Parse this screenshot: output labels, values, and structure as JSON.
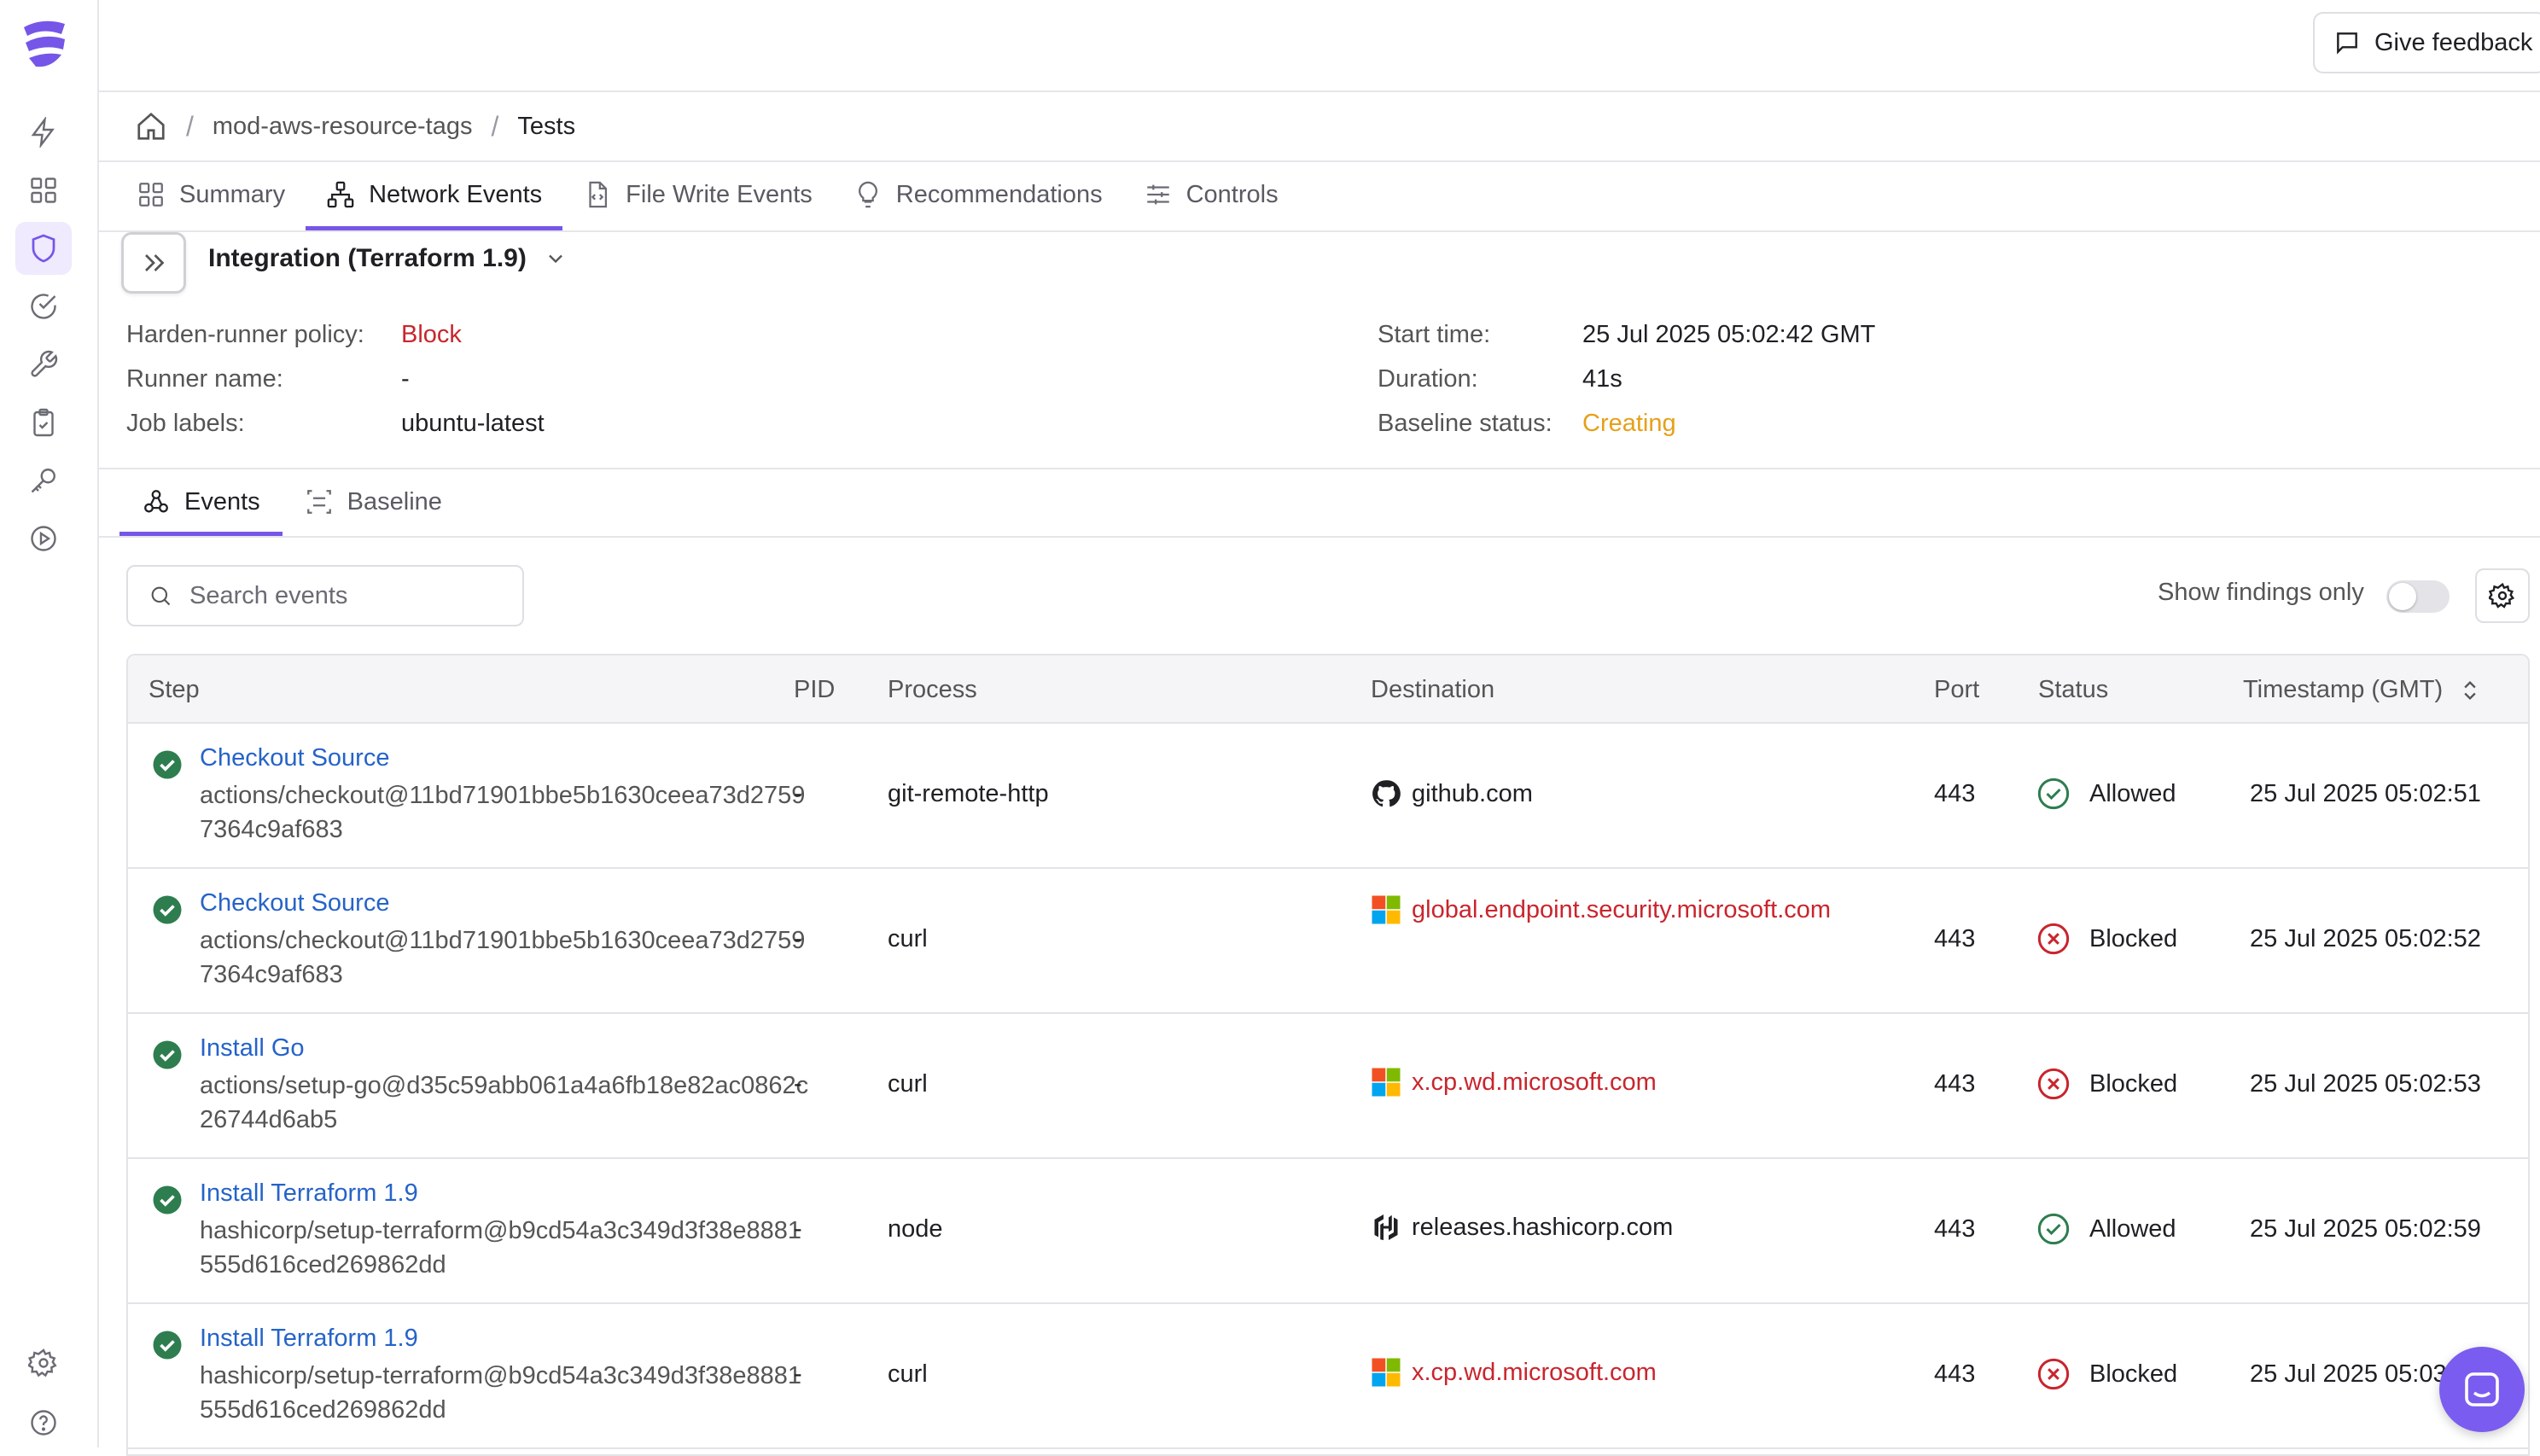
{
  "header": {
    "feedback_label": "Give feedback"
  },
  "breadcrumb": {
    "items": [
      "mod-aws-resource-tags",
      "Tests"
    ]
  },
  "tabs": [
    {
      "label": "Summary",
      "icon": "grid-icon"
    },
    {
      "label": "Network Events",
      "icon": "network-icon",
      "active": true
    },
    {
      "label": "File Write Events",
      "icon": "file-code-icon"
    },
    {
      "label": "Recommendations",
      "icon": "lightbulb-icon"
    },
    {
      "label": "Controls",
      "icon": "sliders-icon"
    }
  ],
  "job": {
    "name": "Integration (Terraform 1.9)",
    "left": [
      {
        "label": "Harden-runner policy:",
        "value": "Block"
      },
      {
        "label": "Runner name:",
        "value": "-"
      },
      {
        "label": "Job labels:",
        "value": "ubuntu-latest"
      }
    ],
    "right": [
      {
        "label": "Start time:",
        "value": "25 Jul 2025 05:02:42 GMT"
      },
      {
        "label": "Duration:",
        "value": "41s"
      },
      {
        "label": "Baseline status:",
        "value": "Creating"
      }
    ]
  },
  "subtabs": [
    {
      "label": "Events",
      "active": true
    },
    {
      "label": "Baseline"
    }
  ],
  "search": {
    "placeholder": "Search events"
  },
  "filters": {
    "findings_label": "Show findings only",
    "findings_enabled": false
  },
  "table": {
    "columns": [
      "Step",
      "PID",
      "Process",
      "Destination",
      "Port",
      "Status",
      "Timestamp (GMT)"
    ],
    "rows": [
      {
        "step": "Checkout Source",
        "action": "actions/checkout@11bd71901bbe5b1630ceea73d27597364c9af683",
        "pid": "-",
        "process": "git-remote-http",
        "destination": "github.com",
        "dest_icon": "github-icon",
        "port": "443",
        "status": "Allowed",
        "timestamp": "25 Jul 2025 05:02:51"
      },
      {
        "step": "Checkout Source",
        "action": "actions/checkout@11bd71901bbe5b1630ceea73d27597364c9af683",
        "pid": "-",
        "process": "curl",
        "destination": "global.endpoint.security.microsoft.com",
        "dest_icon": "microsoft-icon",
        "port": "443",
        "status": "Blocked",
        "timestamp": "25 Jul 2025 05:02:52"
      },
      {
        "step": "Install Go",
        "action": "actions/setup-go@d35c59abb061a4a6fb18e82ac0862c26744d6ab5",
        "pid": "-",
        "process": "curl",
        "destination": "x.cp.wd.microsoft.com",
        "dest_icon": "microsoft-icon",
        "port": "443",
        "status": "Blocked",
        "timestamp": "25 Jul 2025 05:02:53"
      },
      {
        "step": "Install Terraform 1.9",
        "action": "hashicorp/setup-terraform@b9cd54a3c349d3f38e8881555d616ced269862dd",
        "pid": "-",
        "process": "node",
        "destination": "releases.hashicorp.com",
        "dest_icon": "hashicorp-icon",
        "port": "443",
        "status": "Allowed",
        "timestamp": "25 Jul 2025 05:02:59"
      },
      {
        "step": "Install Terraform 1.9",
        "action": "hashicorp/setup-terraform@b9cd54a3c349d3f38e8881555d616ced269862dd",
        "pid": "-",
        "process": "curl",
        "destination": "x.cp.wd.microsoft.com",
        "dest_icon": "microsoft-icon",
        "port": "443",
        "status": "Blocked",
        "timestamp": "25 Jul 2025 05:03:00"
      }
    ]
  },
  "colors": {
    "accent": "#7556e8",
    "link": "#2563c9",
    "blocked": "#c9252d",
    "allowed": "#2e7d4f",
    "creating": "#e6a019"
  }
}
